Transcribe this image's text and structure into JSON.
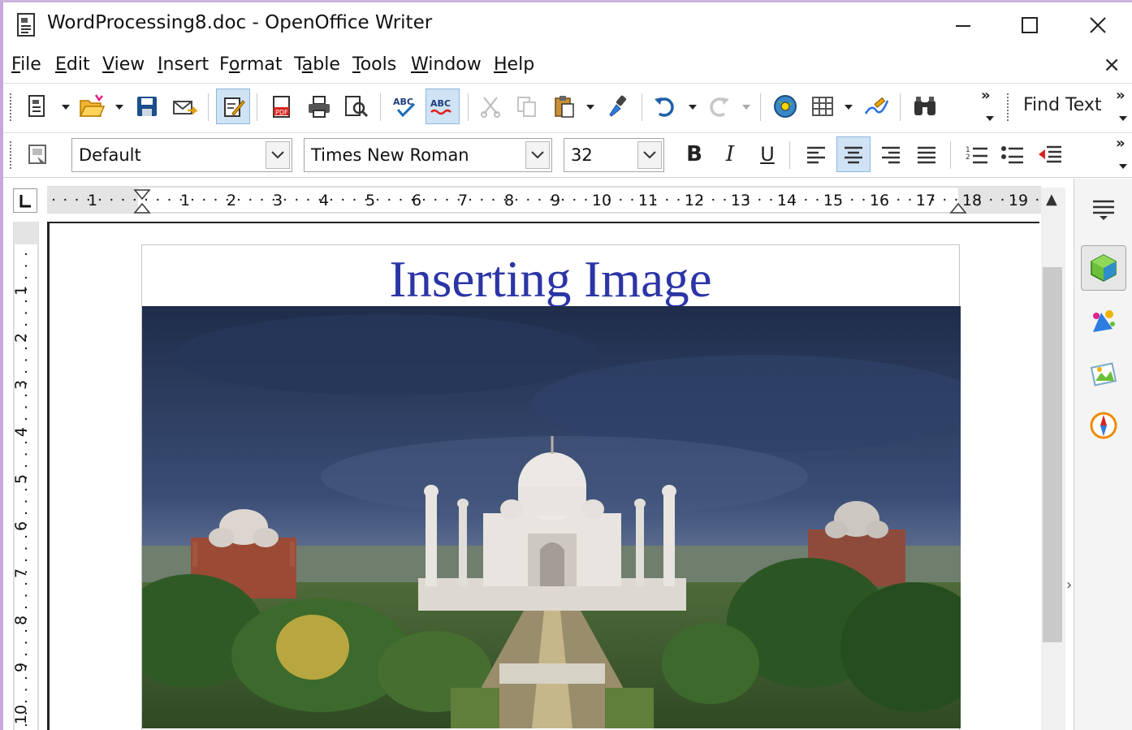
{
  "window": {
    "title": "WordProcessing8.doc - OpenOffice Writer",
    "controls": [
      "minimize",
      "maximize",
      "close"
    ]
  },
  "menubar": {
    "items": [
      {
        "pre": "",
        "u": "F",
        "post": "ile"
      },
      {
        "pre": "",
        "u": "E",
        "post": "dit"
      },
      {
        "pre": "",
        "u": "V",
        "post": "iew"
      },
      {
        "pre": "",
        "u": "I",
        "post": "nsert"
      },
      {
        "pre": "F",
        "u": "o",
        "post": "rmat"
      },
      {
        "pre": "T",
        "u": "a",
        "post": "ble"
      },
      {
        "pre": "",
        "u": "T",
        "post": "ools"
      },
      {
        "pre": "",
        "u": "W",
        "post": "indow"
      },
      {
        "pre": "",
        "u": "H",
        "post": "elp"
      }
    ],
    "close_doc": "×"
  },
  "standard_toolbar": {
    "buttons": [
      "new",
      "open",
      "save",
      "email",
      "edit-file",
      "export-pdf",
      "print",
      "page-preview",
      "spellcheck",
      "auto-spellcheck",
      "cut",
      "copy",
      "paste",
      "clone-formatting",
      "undo",
      "redo",
      "navigator",
      "insert-table",
      "show-draw-functions",
      "find-and-replace"
    ],
    "find_label": "Find Text"
  },
  "formatting_toolbar": {
    "paragraph_style": "Default",
    "font_name": "Times New Roman",
    "font_size": "32",
    "buttons": [
      "bold",
      "italic",
      "underline",
      "align-left",
      "align-center",
      "align-right",
      "justify",
      "numbering",
      "bullets",
      "decrease-indent"
    ],
    "bold_label": "B",
    "italic_label": "I",
    "underline_label": "U"
  },
  "ruler": {
    "ticks": [
      "1",
      "1",
      "2",
      "3",
      "4",
      "5",
      "6",
      "7",
      "8",
      "9",
      "10",
      "11",
      "12",
      "13",
      "14",
      "15",
      "16",
      "17",
      "18",
      "19"
    ],
    "vertical_ticks": [
      "1",
      "2",
      "3",
      "4",
      "5",
      "6",
      "7",
      "8",
      "9",
      "10"
    ]
  },
  "document": {
    "heading": "Inserting Image",
    "heading_color": "#2b35a6",
    "image": "taj-mahal-photo"
  },
  "sidebar": {
    "buttons": [
      "properties",
      "styles-and-formatting",
      "gallery",
      "navigator"
    ]
  }
}
